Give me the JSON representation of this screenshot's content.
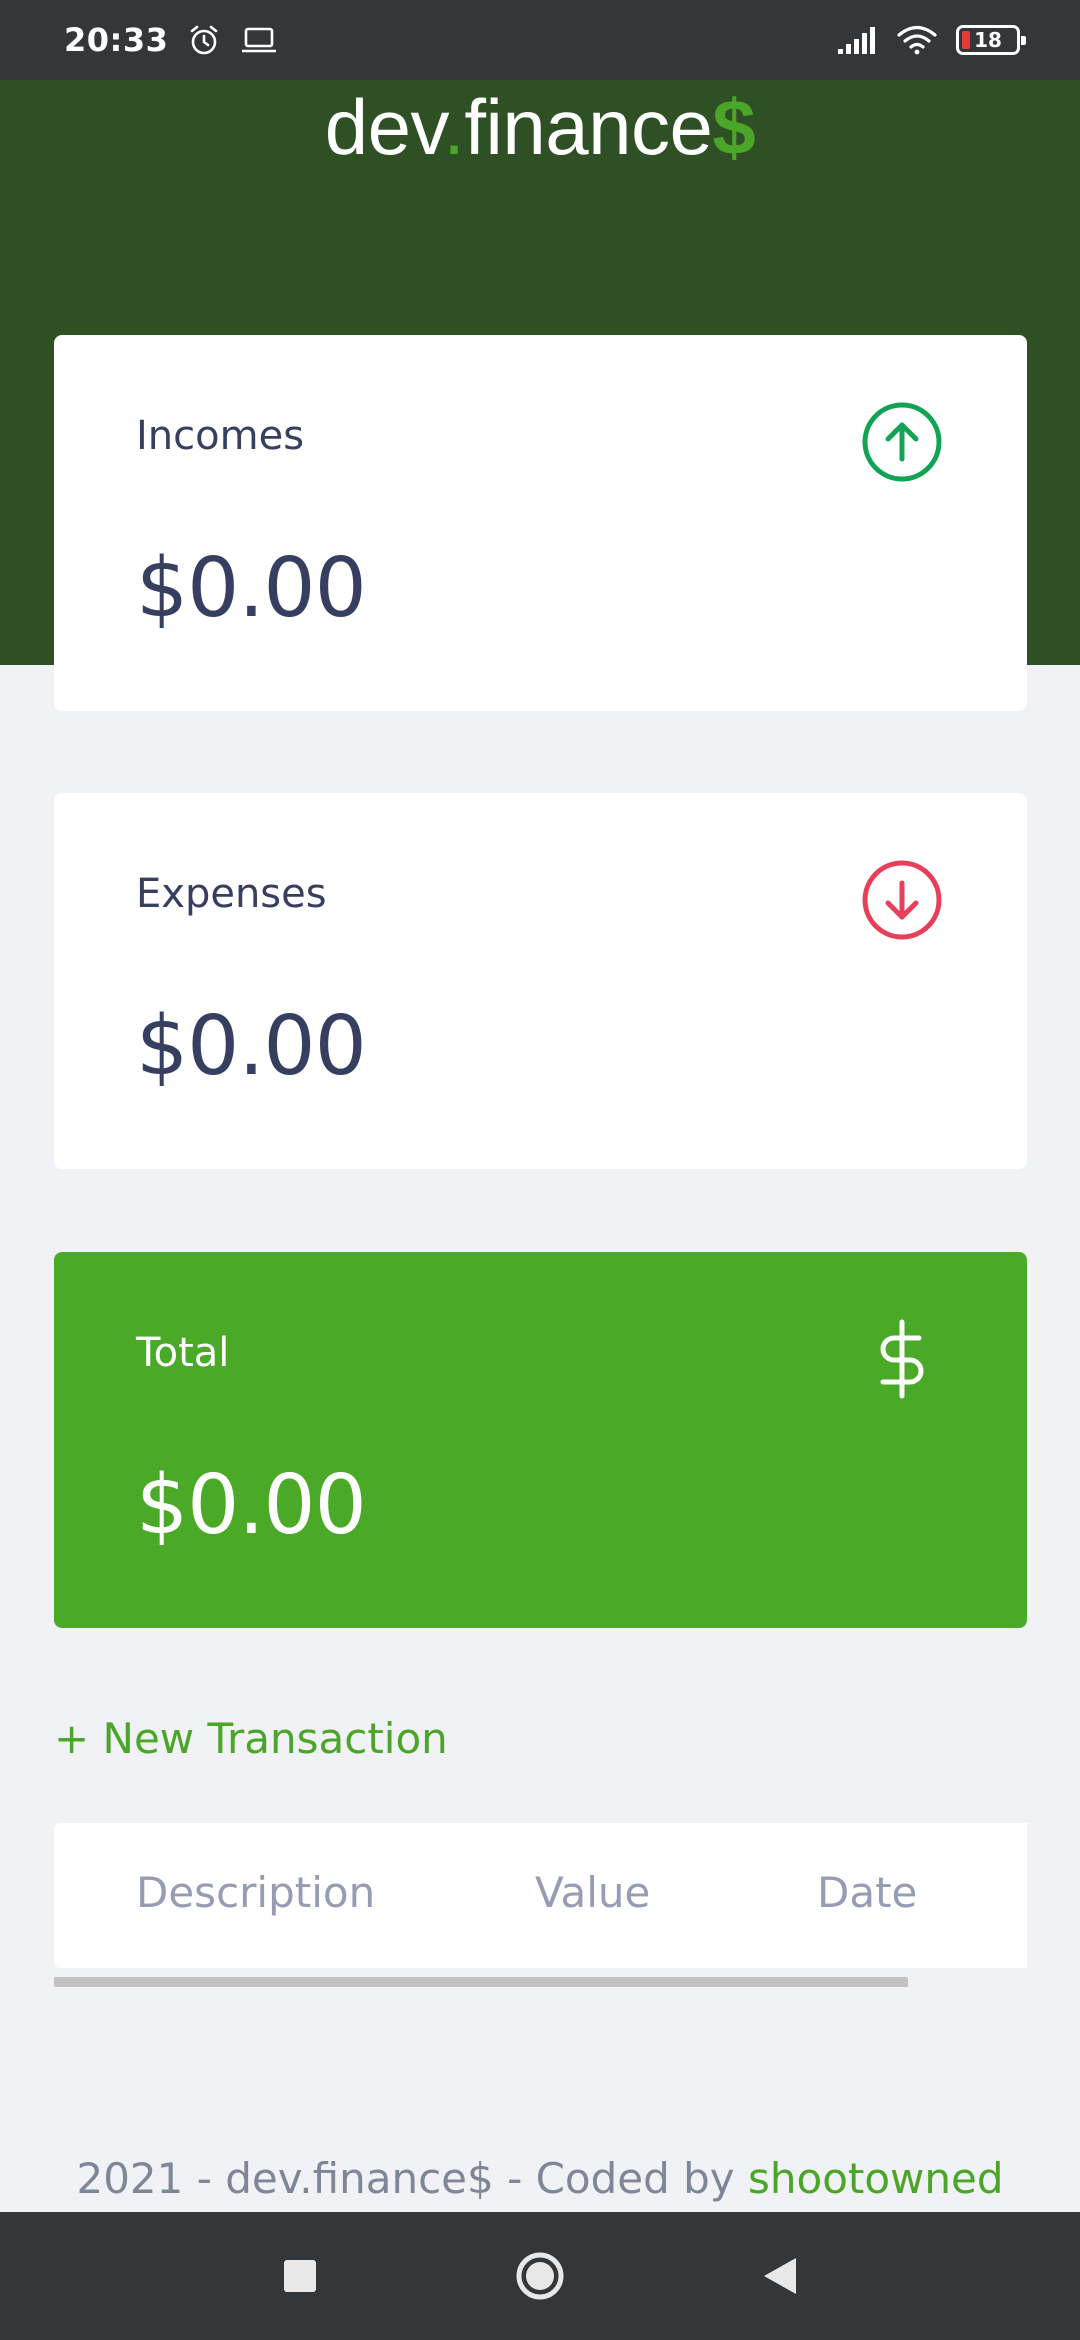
{
  "status_bar": {
    "time": "20:33",
    "battery_level": "18",
    "icons": [
      "alarm-icon",
      "laptop-icon",
      "signal-icon",
      "wifi-icon",
      "battery-icon"
    ]
  },
  "header": {
    "logo_part1": "dev",
    "logo_dot": ".",
    "logo_part2": "finance",
    "logo_dollar": "$"
  },
  "cards": {
    "incomes": {
      "label": "Incomes",
      "value": "$0.00",
      "icon": "arrow-up-circle-icon",
      "icon_color": "#12A454"
    },
    "expenses": {
      "label": "Expenses",
      "value": "$0.00",
      "icon": "arrow-down-circle-icon",
      "icon_color": "#E92929"
    },
    "total": {
      "label": "Total",
      "value": "$0.00",
      "icon": "dollar-sign-icon",
      "background": "#4AAA27"
    }
  },
  "new_transaction": {
    "label": "+ New Transaction"
  },
  "table": {
    "headers": [
      "Description",
      "Value",
      "Date"
    ],
    "rows": []
  },
  "footer": {
    "text": "2021 - dev.finance$ - Coded by ",
    "author": "shootowned"
  },
  "nav_bar": {
    "icons": [
      "recent-apps-icon",
      "home-icon",
      "back-icon"
    ]
  },
  "colors": {
    "header_bg": "#2F4F24",
    "accent": "#4AA528",
    "page_bg": "#F0F2F5",
    "text": "#363F5F"
  }
}
